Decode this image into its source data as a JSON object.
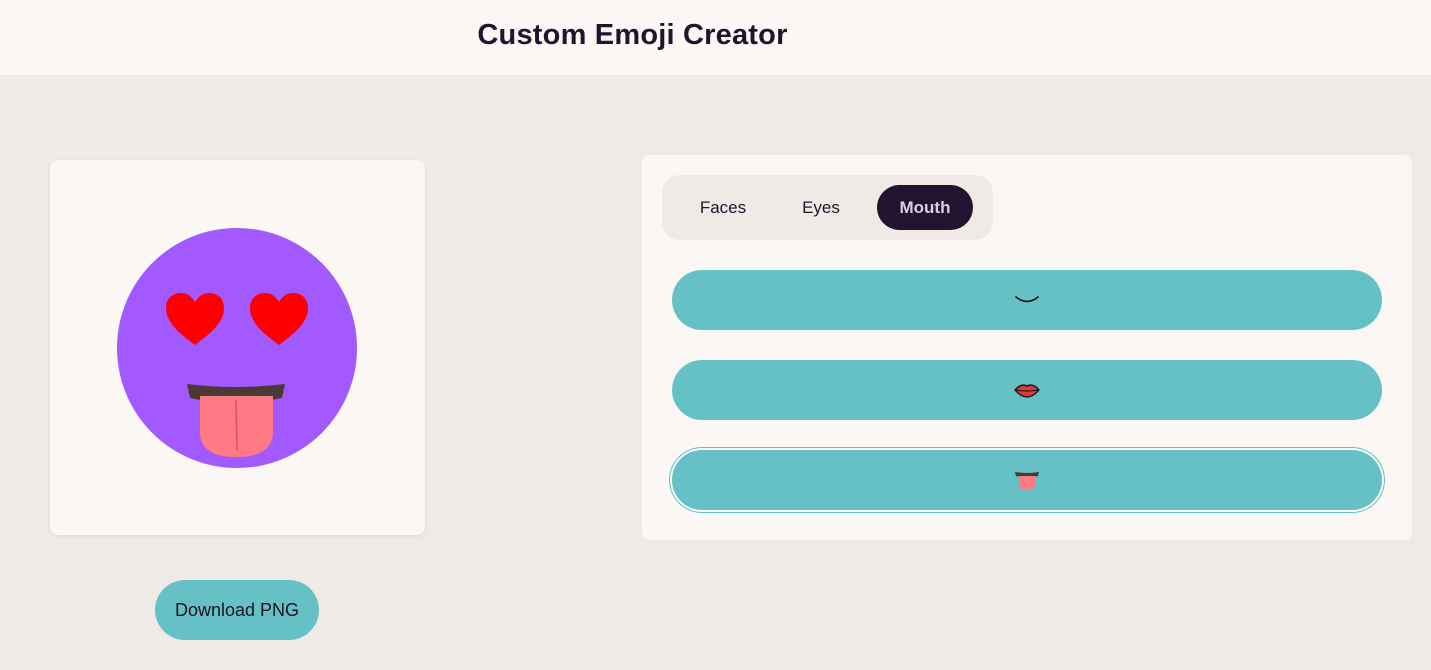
{
  "header": {
    "title": "Custom Emoji Creator"
  },
  "preview": {
    "face_color": "#a259ff",
    "eye_color": "#ff0000",
    "tongue_color": "#ff7a85",
    "mouth_color": "#4a3a34",
    "eyes_icon": "heart-eyes-icon",
    "mouth_icon": "tongue-out-icon"
  },
  "actions": {
    "download_label": "Download PNG"
  },
  "tabs": [
    {
      "label": "Faces",
      "active": false
    },
    {
      "label": "Eyes",
      "active": false
    },
    {
      "label": "Mouth",
      "active": true
    }
  ],
  "mouth_options": [
    {
      "icon": "smile-mouth-icon",
      "selected": false
    },
    {
      "icon": "lips-mouth-icon",
      "selected": false
    },
    {
      "icon": "tongue-mouth-icon",
      "selected": true
    }
  ],
  "colors": {
    "accent": "#66c1c6",
    "dark": "#24132f",
    "background": "#efeae6",
    "card": "#faf7f5"
  }
}
